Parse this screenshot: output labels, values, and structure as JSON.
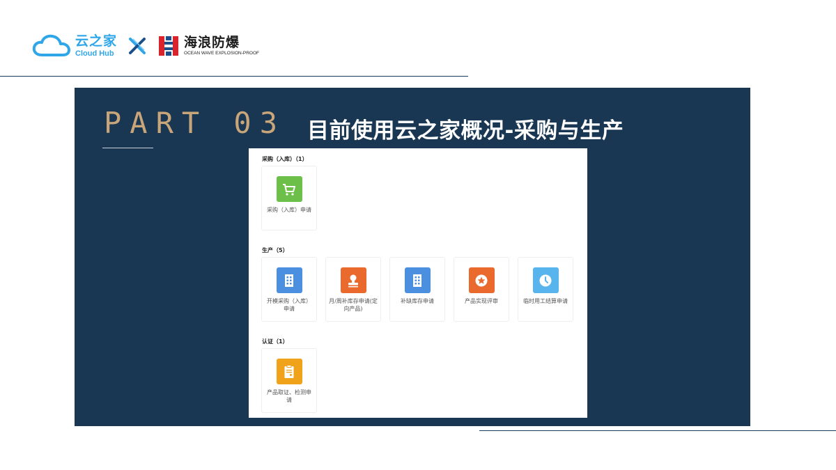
{
  "header": {
    "cloudhub_cn": "云之家",
    "cloudhub_en": "Cloud Hub",
    "partner_cn": "海浪防爆",
    "partner_en": "OCEAN WAVE EXPLOSION-PROOF"
  },
  "panel": {
    "part_label": "PART 03",
    "title": "目前使用云之家概况-采购与生产"
  },
  "colors": {
    "panel_bg": "#193753",
    "part_gold": "#c9a57a",
    "green": "#6cc04a",
    "blue": "#4a8fe0",
    "orange": "#ea6a2e",
    "lightblue": "#57b4ec",
    "amber": "#f0a21a"
  },
  "sections": [
    {
      "title": "采购（入库）（1）",
      "cards": [
        {
          "label": "采购（入库）申请",
          "icon": "cart-icon",
          "color": "#6cc04a"
        }
      ]
    },
    {
      "title": "生产（5）",
      "cards": [
        {
          "label": "开模采购（入库）申请",
          "icon": "building-icon",
          "color": "#4a8fe0"
        },
        {
          "label": "月/周补库存申请(定向产品)",
          "icon": "stamp-icon",
          "color": "#ea6a2e"
        },
        {
          "label": "补缺库存申请",
          "icon": "building-icon",
          "color": "#4a8fe0"
        },
        {
          "label": "产品实现评审",
          "icon": "star-badge-icon",
          "color": "#ea6a2e"
        },
        {
          "label": "临时用工结算申请",
          "icon": "clock-icon",
          "color": "#57b4ec"
        }
      ]
    },
    {
      "title": "认证（1）",
      "cards": [
        {
          "label": "产品取证、检测申请",
          "icon": "clipboard-icon",
          "color": "#f0a21a"
        }
      ]
    }
  ]
}
